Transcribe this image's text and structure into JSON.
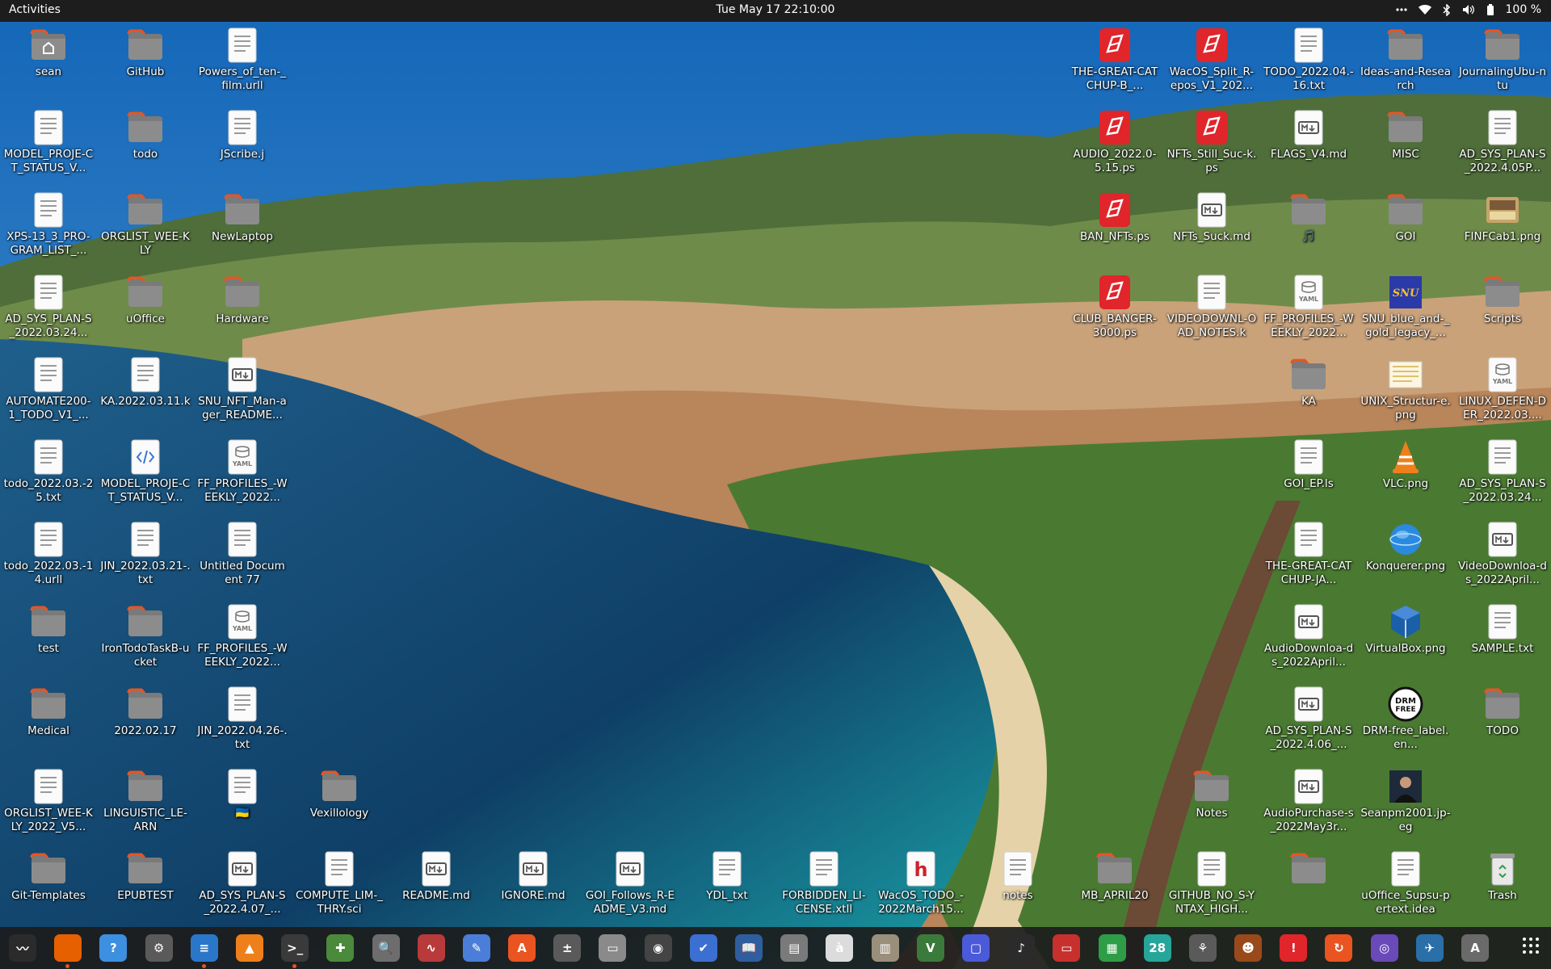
{
  "topbar": {
    "activities": "Activities",
    "clock": "Tue May 17  22:10:00",
    "battery": "100 %",
    "tray_icons": [
      "more-icon",
      "wifi-icon",
      "bluetooth-icon",
      "volume-icon",
      "battery-icon"
    ]
  },
  "desktop": {
    "icons": [
      {
        "label": "sean",
        "type": "home"
      },
      {
        "label": "GitHub",
        "type": "folder"
      },
      {
        "label": "Powers_of_ten-_film.urll",
        "type": "text"
      },
      {
        "label": "MODEL_PROJE-CT_STATUS_V...",
        "type": "text"
      },
      {
        "label": "todo",
        "type": "folder"
      },
      {
        "label": "JScribe.j",
        "type": "text"
      },
      {
        "label": "XPS-13_3_PRO-GRAM_LIST_...",
        "type": "text"
      },
      {
        "label": "ORGLIST_WEE-KLY",
        "type": "folder"
      },
      {
        "label": "NewLaptop",
        "type": "folder"
      },
      {
        "label": "AD_SYS_PLAN-S_2022.03.24...",
        "type": "text"
      },
      {
        "label": "uOffice",
        "type": "folder"
      },
      {
        "label": "Hardware",
        "type": "folder"
      },
      {
        "label": "AUTOMATE200-1_TODO_V1_...",
        "type": "text"
      },
      {
        "label": "KA.2022.03.11.k",
        "type": "text"
      },
      {
        "label": "SNU_NFT_Man-ager_README...",
        "type": "markdown"
      },
      {
        "label": "todo_2022.03.-25.txt",
        "type": "text"
      },
      {
        "label": "MODEL_PROJE-CT_STATUS_V...",
        "type": "code"
      },
      {
        "label": "FF_PROFILES_-WEEKLY_2022...",
        "type": "yaml"
      },
      {
        "label": "todo_2022.03.-14.urll",
        "type": "text"
      },
      {
        "label": "JIN_2022.03.21-.txt",
        "type": "text"
      },
      {
        "label": "Untitled Document 77",
        "type": "text"
      },
      {
        "label": "test",
        "type": "folder"
      },
      {
        "label": "IronTodoTaskB-ucket",
        "type": "folder"
      },
      {
        "label": "FF_PROFILES_-WEEKLY_2022...",
        "type": "yaml"
      },
      {
        "label": "Medical",
        "type": "folder"
      },
      {
        "label": "2022.02.17",
        "type": "folder"
      },
      {
        "label": "JIN_2022.04.26-.txt",
        "type": "text"
      },
      {
        "label": "ORGLIST_WEE-KLY_2022_V5...",
        "type": "text"
      },
      {
        "label": "LINGUISTIC_LE-ARN",
        "type": "folder"
      },
      {
        "label": "🇺🇦",
        "type": "text"
      },
      {
        "label": "Vexillology",
        "type": "folder"
      },
      {
        "label": "Git-Templates",
        "type": "folder"
      },
      {
        "label": "EPUBTEST",
        "type": "folder"
      },
      {
        "label": "AD_SYS_PLAN-S_2022.4.07_...",
        "type": "markdown"
      },
      {
        "label": "COMPUTE_LIM-_THRY.sci",
        "type": "text"
      },
      {
        "label": "README.md",
        "type": "markdown"
      },
      {
        "label": "IGNORE.md",
        "type": "markdown"
      },
      {
        "label": "GOI_Follows_R-EADME_V3.md",
        "type": "markdown"
      },
      {
        "label": "YDL_txt",
        "type": "text"
      },
      {
        "label": "FORBIDDEN_LI-CENSE.xtll",
        "type": "text"
      },
      {
        "label": "WacOS_TODO_-2022March15...",
        "type": "hdoc"
      },
      {
        "label": "notes",
        "type": "text"
      },
      {
        "label": "MB_APRIL20",
        "type": "folder"
      },
      {
        "label": "GITHUB_NO_S-YNTAX_HIGH...",
        "type": "text"
      },
      {
        "label": "",
        "type": "folder"
      },
      {
        "label": "uOffice_Supsu-pertext.idea",
        "type": "text"
      },
      {
        "label": "Trash",
        "type": "trash"
      },
      {
        "label": "THE-GREAT-CATCHUP-B_...",
        "type": "ps"
      },
      {
        "label": "WacOS_Split_R-epos_V1_202...",
        "type": "ps"
      },
      {
        "label": "TODO_2022.04.-16.txt",
        "type": "text"
      },
      {
        "label": "Ideas-and-Research",
        "type": "folder"
      },
      {
        "label": "JournalingUbu-ntu",
        "type": "folder"
      },
      {
        "label": "AUDIO_2022.0-5.15.ps",
        "type": "ps"
      },
      {
        "label": "NFTs_Still_Suc-k.ps",
        "type": "ps"
      },
      {
        "label": "FLAGS_V4.md",
        "type": "markdown"
      },
      {
        "label": "MISC",
        "type": "folder"
      },
      {
        "label": "AD_SYS_PLAN-S_2022.4.05P...",
        "type": "text"
      },
      {
        "label": "BAN_NFTs.ps",
        "type": "ps"
      },
      {
        "label": "NFTs_Suck.md",
        "type": "markdown"
      },
      {
        "label": "🎵",
        "type": "folder"
      },
      {
        "label": "GOI",
        "type": "folder"
      },
      {
        "label": "FINFCab1.png",
        "type": "image"
      },
      {
        "label": "CLUB_BANGER-3000.ps",
        "type": "ps"
      },
      {
        "label": "VIDEODOWNL-OAD_NOTES.k",
        "type": "text"
      },
      {
        "label": "FF_PROFILES_-WEEKLY_2022...",
        "type": "yaml"
      },
      {
        "label": "SNU_blue_and-_gold_legacy_...",
        "type": "image-snu"
      },
      {
        "label": "Scripts",
        "type": "folder"
      },
      {
        "label": "KA",
        "type": "folder"
      },
      {
        "label": "UNIX_Structur-e.png",
        "type": "image-doc"
      },
      {
        "label": "LINUX_DEFEN-DER_2022.03....",
        "type": "yaml"
      },
      {
        "label": "GOI_EP.ls",
        "type": "text"
      },
      {
        "label": "VLC.png",
        "type": "image-vlc"
      },
      {
        "label": "AD_SYS_PLAN-S_2022.03.24...",
        "type": "text"
      },
      {
        "label": "THE-GREAT-CATCHUP-JA...",
        "type": "text"
      },
      {
        "label": "Konquerer.png",
        "type": "image-globe"
      },
      {
        "label": "VideoDownloa-ds_2022April...",
        "type": "markdown"
      },
      {
        "label": "AudioDownloa-ds_2022April...",
        "type": "markdown"
      },
      {
        "label": "VirtualBox.png",
        "type": "image-vbox"
      },
      {
        "label": "SAMPLE.txt",
        "type": "text"
      },
      {
        "label": "AD_SYS_PLAN-S_2022.4.06_...",
        "type": "markdown"
      },
      {
        "label": "DRM-free_label.en...",
        "type": "image-drm"
      },
      {
        "label": "TODO",
        "type": "folder"
      },
      {
        "label": "Notes",
        "type": "folder"
      },
      {
        "label": "AudioPurchase-s_2022May3r...",
        "type": "markdown"
      },
      {
        "label": "Seanpm2001.jp-eg",
        "type": "image-photo"
      }
    ]
  },
  "dock": {
    "items": [
      {
        "name": "system-monitor",
        "glyph": "〰",
        "color": "#2b2b2b"
      },
      {
        "name": "firefox",
        "glyph": "",
        "color": "#e66000"
      },
      {
        "name": "help",
        "glyph": "?",
        "color": "#3d8fe0"
      },
      {
        "name": "settings",
        "glyph": "⚙",
        "color": "#5a5a5a"
      },
      {
        "name": "libreoffice-writer",
        "glyph": "≡",
        "color": "#2a77c9"
      },
      {
        "name": "vlc",
        "glyph": "▲",
        "color": "#ef7f1a"
      },
      {
        "name": "terminal",
        "glyph": ">_",
        "color": "#3a3a3a"
      },
      {
        "name": "gnome-mines",
        "glyph": "✚",
        "color": "#4a8a3a"
      },
      {
        "name": "image-viewer",
        "glyph": "🔍",
        "color": "#6d6d6d"
      },
      {
        "name": "system-monitor-2",
        "glyph": "∿",
        "color": "#b93a3a"
      },
      {
        "name": "text-editor",
        "glyph": "✎",
        "color": "#4a7ed8"
      },
      {
        "name": "software",
        "glyph": "A",
        "color": "#e95420"
      },
      {
        "name": "calculator",
        "glyph": "±",
        "color": "#5a5a5a"
      },
      {
        "name": "files",
        "glyph": "▭",
        "color": "#8a8a8a"
      },
      {
        "name": "disc-burner",
        "glyph": "◉",
        "color": "#444444"
      },
      {
        "name": "todo",
        "glyph": "✔",
        "color": "#3b6fd1"
      },
      {
        "name": "book-reader",
        "glyph": "📖",
        "color": "#2e5e9e"
      },
      {
        "name": "document-scanner",
        "glyph": "▤",
        "color": "#7a7a7a"
      },
      {
        "name": "character-map",
        "glyph": "à",
        "color": "#dcdcdc"
      },
      {
        "name": "archive-manager",
        "glyph": "▥",
        "color": "#9a8f7a"
      },
      {
        "name": "vim",
        "glyph": "V",
        "color": "#3a7a3a"
      },
      {
        "name": "screen-share",
        "glyph": "▢",
        "color": "#4a5ad8"
      },
      {
        "name": "music",
        "glyph": "♪",
        "color": "#2b2b2b"
      },
      {
        "name": "pdf-viewer",
        "glyph": "▭",
        "color": "#c8302e"
      },
      {
        "name": "spreadsheet",
        "glyph": "▦",
        "color": "#2f9d48"
      },
      {
        "name": "calendar",
        "glyph": "28",
        "color": "#26a69a"
      },
      {
        "name": "tweaks",
        "glyph": "⚘",
        "color": "#5a5a5a"
      },
      {
        "name": "retro-game",
        "glyph": "☻",
        "color": "#9a4a1a"
      },
      {
        "name": "alert-app",
        "glyph": "!",
        "color": "#e0252b"
      },
      {
        "name": "backup",
        "glyph": "↻",
        "color": "#e95420"
      },
      {
        "name": "camera",
        "glyph": "◎",
        "color": "#6a4ab8"
      },
      {
        "name": "sky-app",
        "glyph": "✈",
        "color": "#2a6fa8"
      },
      {
        "name": "updater",
        "glyph": "A",
        "color": "#6a6a6a"
      }
    ]
  }
}
